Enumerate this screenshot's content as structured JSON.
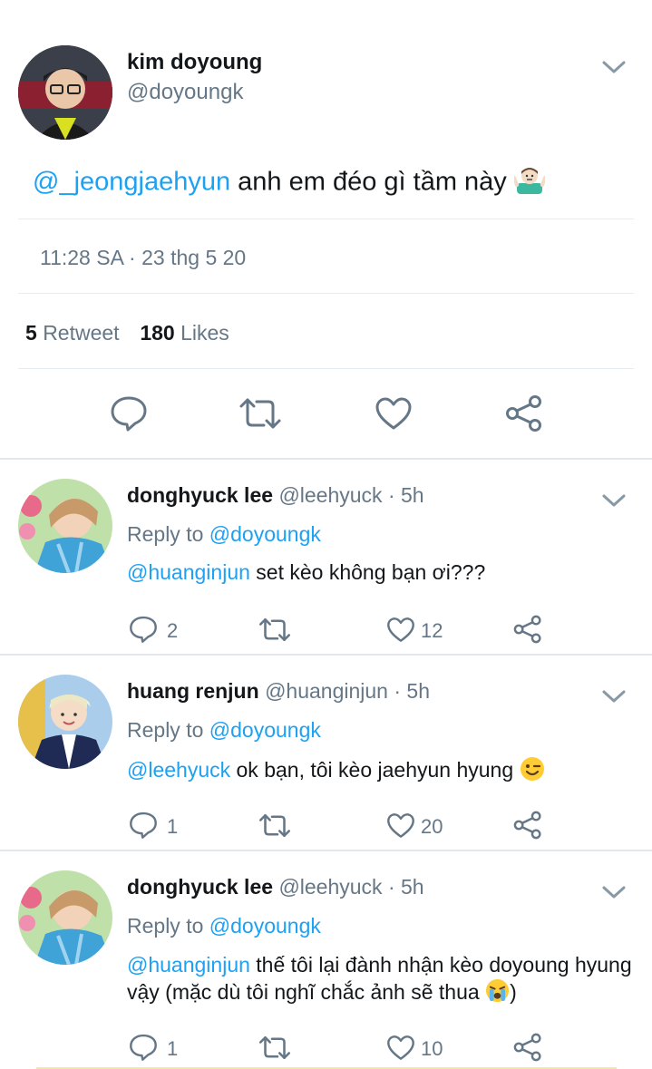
{
  "tweet": {
    "author_name": "kim doyoung",
    "author_handle": "@doyoungk",
    "mention": "@_jeongjaehyun",
    "text": " anh em đéo gì tầm này ",
    "time": "11:28 SA",
    "dot": "·",
    "date": "23 thg 5 20",
    "retweets_count": "5",
    "retweets_label": "Retweet",
    "likes_count": "180",
    "likes_label": "Likes"
  },
  "replies": [
    {
      "name": "donghyuck lee",
      "handle": "@leehyuck",
      "time": "· 5h",
      "reply_to_label": "Reply to",
      "reply_to_handle": "@doyoungk",
      "mention": "@huanginjun",
      "text": " set kèo không bạn ơi???",
      "replies": "2",
      "retweets": "",
      "likes": "12"
    },
    {
      "name": "huang renjun",
      "handle": "@huanginjun",
      "time": "· 5h",
      "reply_to_label": "Reply to",
      "reply_to_handle": "@doyoungk",
      "mention": "@leehyuck",
      "text": " ok bạn, tôi kèo jaehyun hyung ",
      "replies": "1",
      "retweets": "",
      "likes": "20"
    },
    {
      "name": "donghyuck lee",
      "handle": "@leehyuck",
      "time": "· 5h",
      "reply_to_label": "Reply to",
      "reply_to_handle": "@doyoungk",
      "mention": "@huanginjun",
      "text": " thế tôi lại đành nhận kèo doyoung hyung vậy (mặc dù tôi nghĩ chắc ảnh sẽ thua ",
      "text_end": ")",
      "replies": "1",
      "retweets": "",
      "likes": "10"
    }
  ],
  "colors": {
    "accent": "#1da1f2",
    "muted": "#657786",
    "divider": "#e6ecf0"
  },
  "icons": [
    "reply-icon",
    "retweet-icon",
    "like-icon",
    "share-icon",
    "chevron-down-icon",
    "shrug-emoji",
    "wink-emoji",
    "crying-emoji"
  ]
}
